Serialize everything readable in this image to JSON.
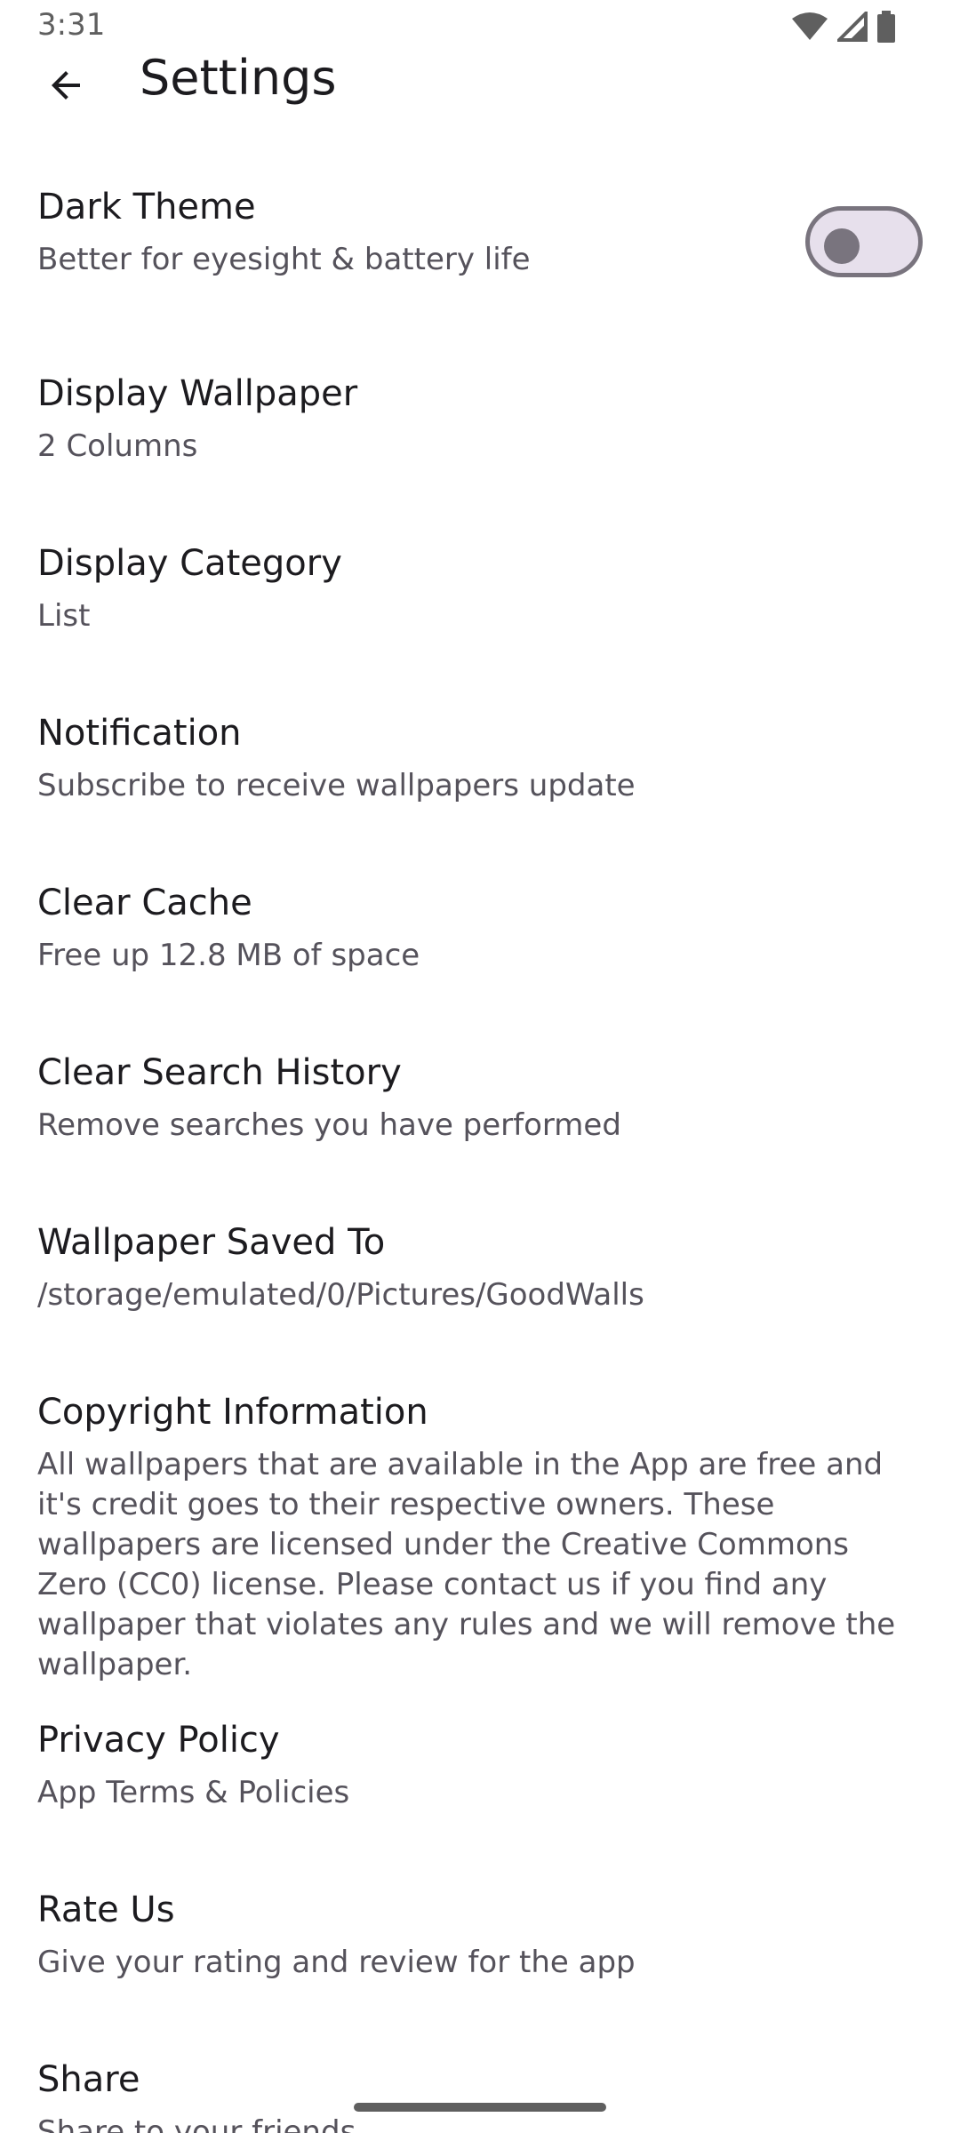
{
  "status_bar": {
    "time": "3:31",
    "icons": [
      "wifi-icon",
      "cellular-signal-icon",
      "battery-icon"
    ]
  },
  "app_bar": {
    "back_icon": "arrow-back-icon",
    "title": "Settings"
  },
  "settings": [
    {
      "key": "dark-theme",
      "title": "Dark Theme",
      "summary": "Better for eyesight & battery life",
      "toggle": {
        "on": false
      }
    },
    {
      "key": "display-wallpaper",
      "title": "Display Wallpaper",
      "summary": "2 Columns"
    },
    {
      "key": "display-category",
      "title": "Display Category",
      "summary": "List"
    },
    {
      "key": "notification",
      "title": "Notification",
      "summary": "Subscribe to receive wallpapers update"
    },
    {
      "key": "clear-cache",
      "title": "Clear Cache",
      "summary": "Free up 12.8 MB of space"
    },
    {
      "key": "clear-search-history",
      "title": "Clear Search History",
      "summary": "Remove searches you have performed"
    },
    {
      "key": "wallpaper-saved-to",
      "title": "Wallpaper Saved To",
      "summary": "/storage/emulated/0/Pictures/GoodWalls"
    },
    {
      "key": "copyright-information",
      "title": "Copyright Information",
      "summary": "All wallpapers that are available in the App are free and it's credit goes to their respective owners. These wallpapers are licensed under the Creative Commons Zero (CC0) license. Please contact us if you find any wallpaper that violates any rules and we will remove the wallpaper."
    },
    {
      "key": "privacy-policy",
      "title": "Privacy Policy",
      "summary": "App Terms & Policies"
    },
    {
      "key": "rate-us",
      "title": "Rate Us",
      "summary": "Give your rating and review for the app"
    },
    {
      "key": "share",
      "title": "Share",
      "summary": "Share to your friends"
    }
  ],
  "colors": {
    "title_text": "#1c1b1f",
    "summary_text": "#55525b",
    "toggle_track": "#e7e0ec",
    "toggle_outline": "#79747e"
  }
}
